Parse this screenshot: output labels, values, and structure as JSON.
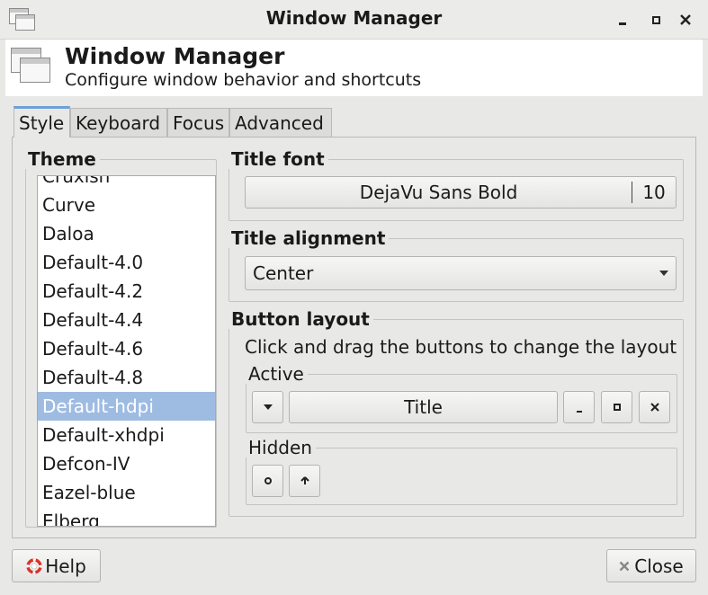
{
  "window": {
    "title": "Window Manager",
    "icon": "window-manager-icon",
    "controls": [
      "minimize-icon",
      "maximize-icon",
      "close-icon"
    ]
  },
  "header": {
    "title": "Window Manager",
    "subtitle": "Configure window behavior and shortcuts"
  },
  "tabs": [
    {
      "label": "Style",
      "active": true
    },
    {
      "label": "Keyboard",
      "active": false
    },
    {
      "label": "Focus",
      "active": false
    },
    {
      "label": "Advanced",
      "active": false
    }
  ],
  "theme": {
    "label": "Theme",
    "items": [
      "Cruxish",
      "Curve",
      "Daloa",
      "Default-4.0",
      "Default-4.2",
      "Default-4.4",
      "Default-4.6",
      "Default-4.8",
      "Default-hdpi",
      "Default-xhdpi",
      "Defcon-IV",
      "Eazel-blue",
      "Elberg"
    ],
    "selected": "Default-hdpi"
  },
  "title_font": {
    "label": "Title font",
    "font_name": "DejaVu Sans Bold",
    "font_size": "10"
  },
  "title_alignment": {
    "label": "Title alignment",
    "value": "Center"
  },
  "button_layout": {
    "label": "Button layout",
    "hint": "Click and drag the buttons to change the layout",
    "active_label": "Active",
    "active_title": "Title",
    "hidden_label": "Hidden"
  },
  "footer": {
    "help_label": "Help",
    "close_label": "Close"
  },
  "colors": {
    "selection": "#9ebbe2",
    "tab_accent": "#6f9fd8",
    "help_icon": "#d9342b"
  }
}
